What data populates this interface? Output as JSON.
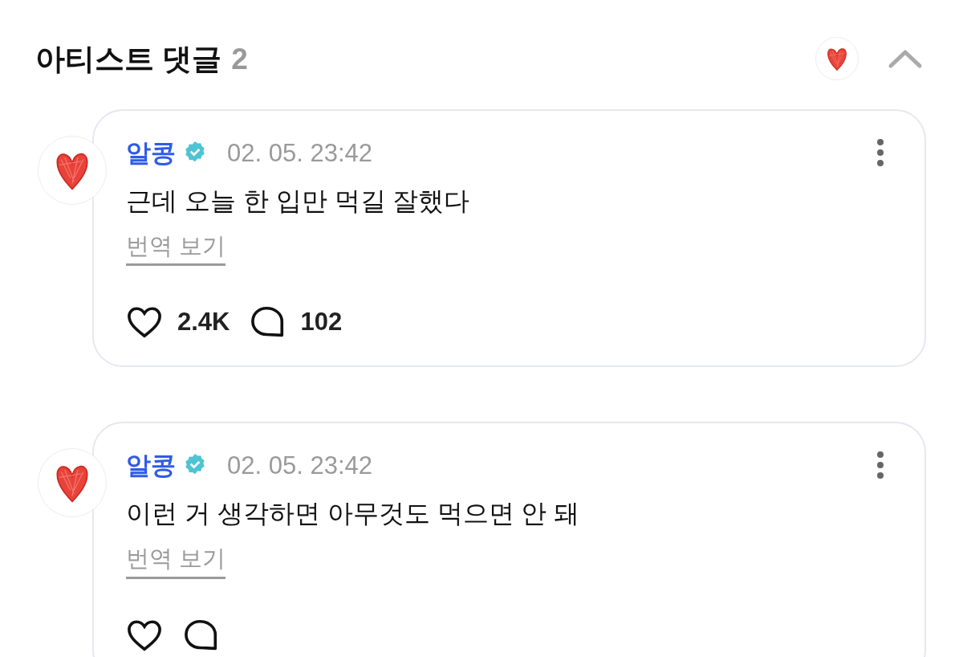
{
  "header": {
    "title": "아티스트 댓글",
    "count": "2",
    "expanded": true
  },
  "comments": [
    {
      "author": "알콩",
      "verified": true,
      "time": "02. 05. 23:42",
      "text": "근데 오늘 한 입만 먹길 잘했다",
      "translate": "번역 보기",
      "likes": "2.4K",
      "replies": "102"
    },
    {
      "author": "알콩",
      "verified": true,
      "time": "02. 05. 23:42",
      "text": "이런 거 생각하면 아무것도 먹으면 안 돼",
      "translate": "번역 보기"
    }
  ]
}
